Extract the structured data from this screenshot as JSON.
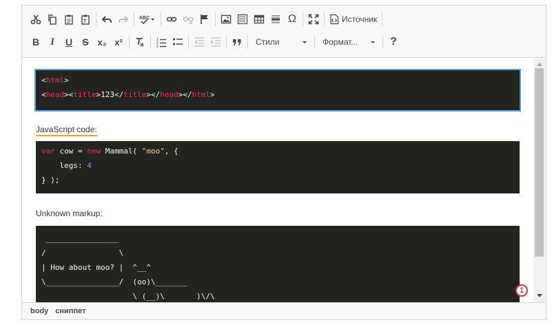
{
  "toolbar": {
    "source_label": "Источник",
    "styles_label": "Стили",
    "format_label": "Формат...",
    "help_label": "?",
    "bold_label": "B",
    "italic_label": "I",
    "underline_label": "U",
    "strike_label": "S",
    "subscript_label": "x₂",
    "superscript_label": "x²",
    "special_char_label": "Ω",
    "icons": [
      "cut-icon",
      "copy-icon",
      "paste-icon",
      "paste-text-icon",
      "undo-icon",
      "redo-icon",
      "spellcheck-icon",
      "link-icon",
      "unlink-icon",
      "anchor-icon",
      "image-icon",
      "codesnippet-icon",
      "table-icon",
      "horizontal-line-icon",
      "special-char-icon",
      "maximize-icon",
      "source-icon",
      "bold-icon",
      "italic-icon",
      "underline-icon",
      "strike-icon",
      "subscript-icon",
      "superscript-icon",
      "remove-format-icon",
      "numbered-list-icon",
      "bulleted-list-icon",
      "outdent-icon",
      "indent-icon",
      "blockquote-icon",
      "help-icon"
    ]
  },
  "content": {
    "snippet1": {
      "line1": [
        "<",
        "html",
        ">"
      ],
      "line2": [
        "<",
        "head",
        "><",
        "title",
        ">123</",
        "title",
        "></",
        "head",
        "></",
        "html",
        ">"
      ]
    },
    "para1": "JavaScript code:",
    "snippet2": {
      "line1": [
        "var",
        " cow = ",
        "new",
        " Mammal( ",
        "\"moo\"",
        ", {"
      ],
      "line2": [
        "    legs: ",
        "4"
      ],
      "line3": "} );"
    },
    "para2": "Unknown markup:",
    "snippet3": {
      "line1": " ________________",
      "line2": "/                \\",
      "line3": "| How about moo? |  ^__^",
      "line4": "\\________________/  (oo)\\_______",
      "line5": "                    \\ (__)\\       )\\/\\"
    },
    "badge": "1"
  },
  "statusbar": {
    "path": [
      "body",
      "сниппет"
    ]
  },
  "colors": {
    "code_bg": "#23241f",
    "tag": "#f92672",
    "string": "#e6db74",
    "number": "#ae81ff",
    "selection_outline": "#5a9ee8",
    "spell_underline": "#f0a030",
    "badge": "#dd3333"
  }
}
